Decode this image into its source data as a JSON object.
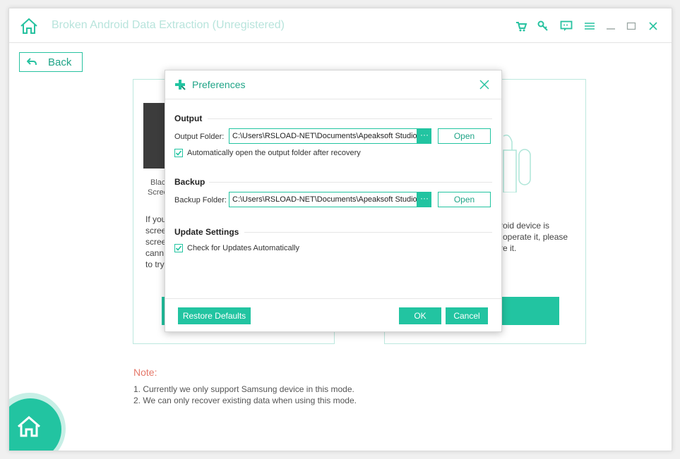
{
  "app": {
    "title": "Broken Android Data Extraction (Unregistered)",
    "accent": "#22c4a1"
  },
  "toolbar": {
    "icons": [
      "cart-icon",
      "key-icon",
      "feedback-icon",
      "menu-icon",
      "minimize-icon",
      "maximize-icon",
      "close-icon"
    ]
  },
  "nav": {
    "back_label": "Back"
  },
  "left_panel": {
    "label_line1": "Black",
    "label_line2": "Scree",
    "text_lines": [
      "If you",
      "scree",
      "scree",
      "cann",
      "to try"
    ]
  },
  "right_panel": {
    "text_lines": [
      "roid device is",
      "operate it, please",
      "re it."
    ]
  },
  "notes": {
    "title": "Note:",
    "lines": [
      "1. Currently we only support Samsung device in this mode.",
      "2. We can only recover existing data when using this mode."
    ]
  },
  "dialog": {
    "title": "Preferences",
    "output": {
      "section": "Output",
      "folder_label": "Output Folder:",
      "folder_value": "C:\\Users\\RSLOAD-NET\\Documents\\Apeaksoft Studio\\A",
      "browse_label": "···",
      "open_label": "Open",
      "auto_open_label": "Automatically open the output folder after recovery",
      "auto_open_checked": true
    },
    "backup": {
      "section": "Backup",
      "folder_label": "Backup Folder:",
      "folder_value": "C:\\Users\\RSLOAD-NET\\Documents\\Apeaksoft Studio\\A",
      "browse_label": "···",
      "open_label": "Open"
    },
    "updates": {
      "section": "Update Settings",
      "check_label": "Check for Updates Automatically",
      "check_checked": true
    },
    "buttons": {
      "restore": "Restore Defaults",
      "ok": "OK",
      "cancel": "Cancel"
    }
  }
}
